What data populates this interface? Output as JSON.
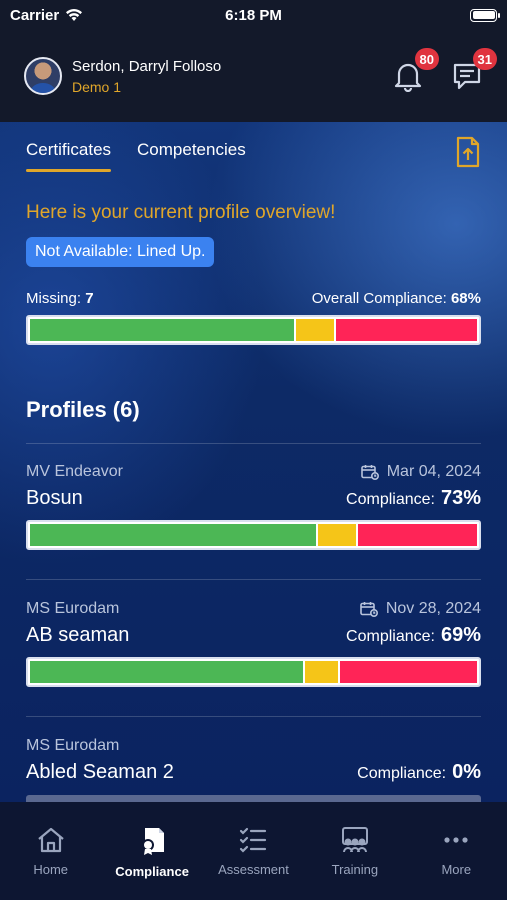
{
  "status_bar": {
    "carrier": "Carrier",
    "time": "6:18 PM"
  },
  "header": {
    "user_name": "Serdon, Darryl Folloso",
    "user_sub": "Demo 1",
    "notifications_count": "80",
    "messages_count": "31"
  },
  "tabs": [
    {
      "label": "Certificates",
      "active": true
    },
    {
      "label": "Competencies",
      "active": false
    }
  ],
  "overview": {
    "title": "Here is your current profile overview!",
    "availability": "Not Available: Lined Up.",
    "missing_label": "Missing:",
    "missing_value": "7",
    "overall_label": "Overall Compliance:",
    "overall_value": "68%",
    "bar": {
      "green": 0.59,
      "yellow": 0.09,
      "red": 0.32
    }
  },
  "profiles": {
    "title": "Profiles (6)",
    "items": [
      {
        "vessel": "MV Endeavor",
        "date": "Mar 04, 2024",
        "role": "Bosun",
        "compliance_label": "Compliance:",
        "compliance": "73%",
        "bar": {
          "green": 0.64,
          "yellow": 0.09,
          "red": 0.27
        }
      },
      {
        "vessel": "MS Eurodam",
        "date": "Nov 28, 2024",
        "role": "AB seaman",
        "compliance_label": "Compliance:",
        "compliance": "69%",
        "bar": {
          "green": 0.61,
          "yellow": 0.08,
          "red": 0.31
        }
      },
      {
        "vessel": "MS Eurodam",
        "date": "",
        "role": "Abled Seaman 2",
        "compliance_label": "Compliance:",
        "compliance": "0%"
      }
    ]
  },
  "colors": {
    "green": "#4cb755",
    "yellow": "#f5c518",
    "red": "#ff2457",
    "accent": "#e0a62a"
  },
  "nav": [
    {
      "label": "Home",
      "icon": "home-icon",
      "active": false
    },
    {
      "label": "Compliance",
      "icon": "compliance-icon",
      "active": true
    },
    {
      "label": "Assessment",
      "icon": "assessment-icon",
      "active": false
    },
    {
      "label": "Training",
      "icon": "training-icon",
      "active": false
    },
    {
      "label": "More",
      "icon": "more-icon",
      "active": false
    }
  ]
}
